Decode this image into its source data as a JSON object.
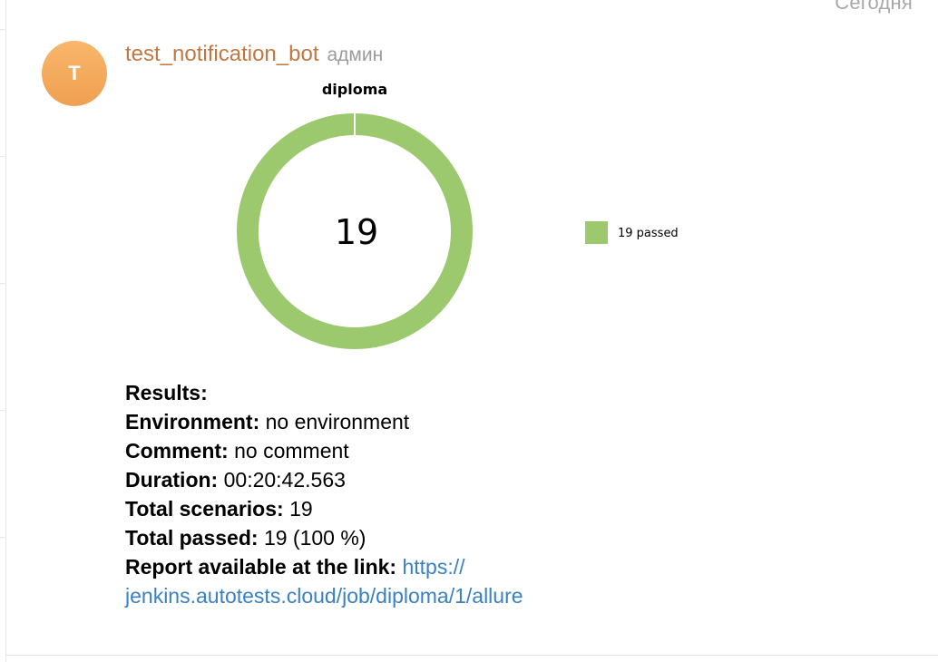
{
  "date_divider": "Сегодня",
  "message": {
    "avatar_letter": "T",
    "sender": "test_notification_bot",
    "role": "админ"
  },
  "chart_data": {
    "type": "pie",
    "title": "diploma",
    "center_label": "19",
    "slices": [
      {
        "label": "19 passed",
        "value": 19,
        "color": "#9dc96e"
      }
    ],
    "legend": [
      "19 passed"
    ],
    "legend_position": "right"
  },
  "results": {
    "heading": "Results:",
    "environment_label": "Environment:",
    "environment_value": "no environment",
    "comment_label": "Comment:",
    "comment_value": "no comment",
    "duration_label": "Duration:",
    "duration_value": "00:20:42.563",
    "scenarios_label": "Total scenarios:",
    "scenarios_value": "19",
    "passed_label": "Total passed:",
    "passed_value": "19 (100 %)",
    "report_label": "Report available at the link:",
    "report_link_part1": "https://",
    "report_link_part2": "jenkins.autotests.cloud/job/diploma/1/allure"
  },
  "colors": {
    "accent_sender": "#c3773e",
    "link": "#3a80c4",
    "passed": "#9dc96e",
    "avatar": "#f0a050"
  }
}
